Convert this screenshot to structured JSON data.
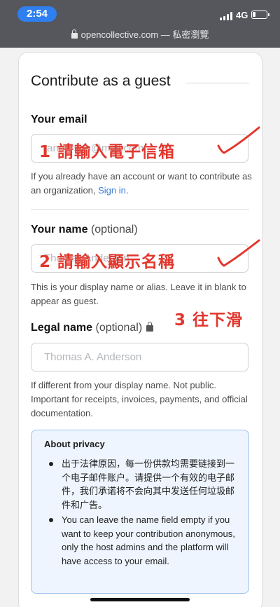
{
  "status": {
    "time": "2:54",
    "network": "4G"
  },
  "browser": {
    "url_text": "opencollective.com — 私密瀏覽"
  },
  "form": {
    "title": "Contribute as a guest",
    "email": {
      "label": "Your email",
      "placeholder": "tanderson@mail.com",
      "help_prefix": "If you already have an account or want to contribute as an organization, ",
      "signin": "Sign in",
      "help_suffix": "."
    },
    "name": {
      "label": "Your name",
      "optional": "(optional)",
      "placeholder": "Thomas Anderson",
      "help": "This is your display name or alias. Leave it in blank to appear as guest."
    },
    "legal": {
      "label": "Legal name",
      "optional": "(optional)",
      "placeholder": "Thomas A. Anderson",
      "help": "If different from your display name. Not public. Important for receipts, invoices, payments, and official documentation."
    },
    "privacy": {
      "title": "About privacy",
      "items": [
        "出于法律原因，每一份供款均需要链接到一个电子邮件账户。请提供一个有效的电子邮件，我们承诺将不会向其中发送任何垃圾邮件和广告。",
        "You can leave the name field empty if you want to keep your contribution anonymous, only the host admins and the platform will have access to your email."
      ]
    }
  },
  "annotations": {
    "step1": "1 請輸入電子信箱",
    "step2": "2 請輸入顯示名稱",
    "step3": "3 往下滑",
    "color": "#e2372e"
  }
}
